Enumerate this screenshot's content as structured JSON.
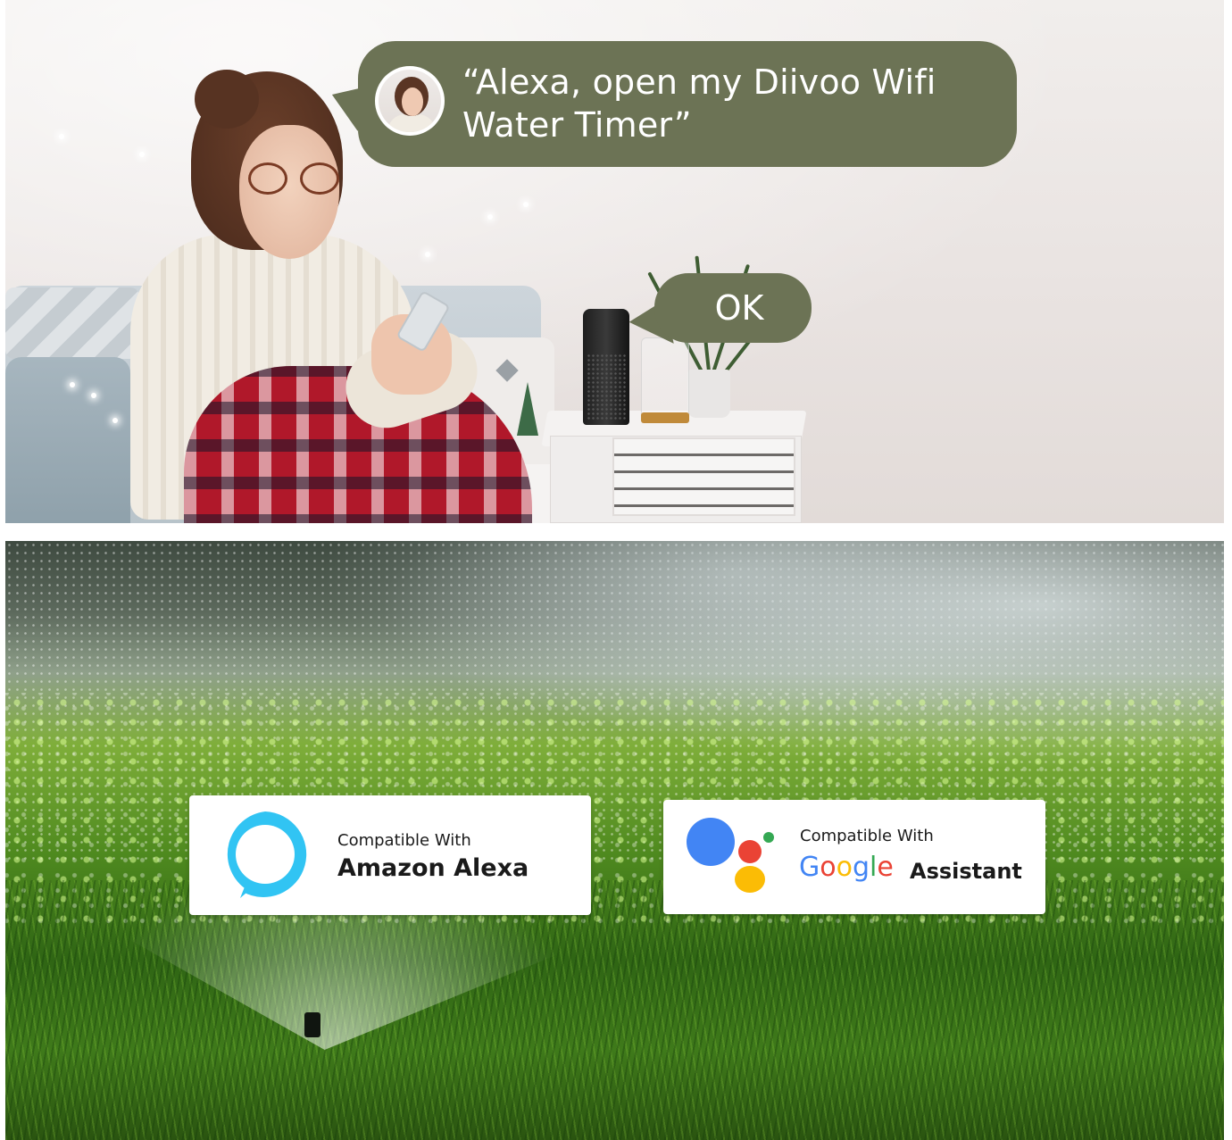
{
  "speech": {
    "user_line_1": "“Alexa, open my Diivoo Wifi",
    "user_line_2": "Water Timer”",
    "reply": "OK"
  },
  "badges": {
    "alexa": {
      "compatible_label": "Compatible With",
      "brand": "Amazon Alexa",
      "icon": "alexa-ring-icon",
      "icon_color": "#31c4f3"
    },
    "google": {
      "compatible_label": "Compatible With",
      "google_letters": [
        "G",
        "o",
        "o",
        "g",
        "l",
        "e"
      ],
      "assistant": "Assistant",
      "icon": "google-assistant-dots-icon",
      "dot_colors": [
        "#4285f4",
        "#ea4335",
        "#fbbc05",
        "#34a853"
      ]
    }
  },
  "colors": {
    "bubble": "#6c7355",
    "bubble_text": "#ffffff"
  }
}
